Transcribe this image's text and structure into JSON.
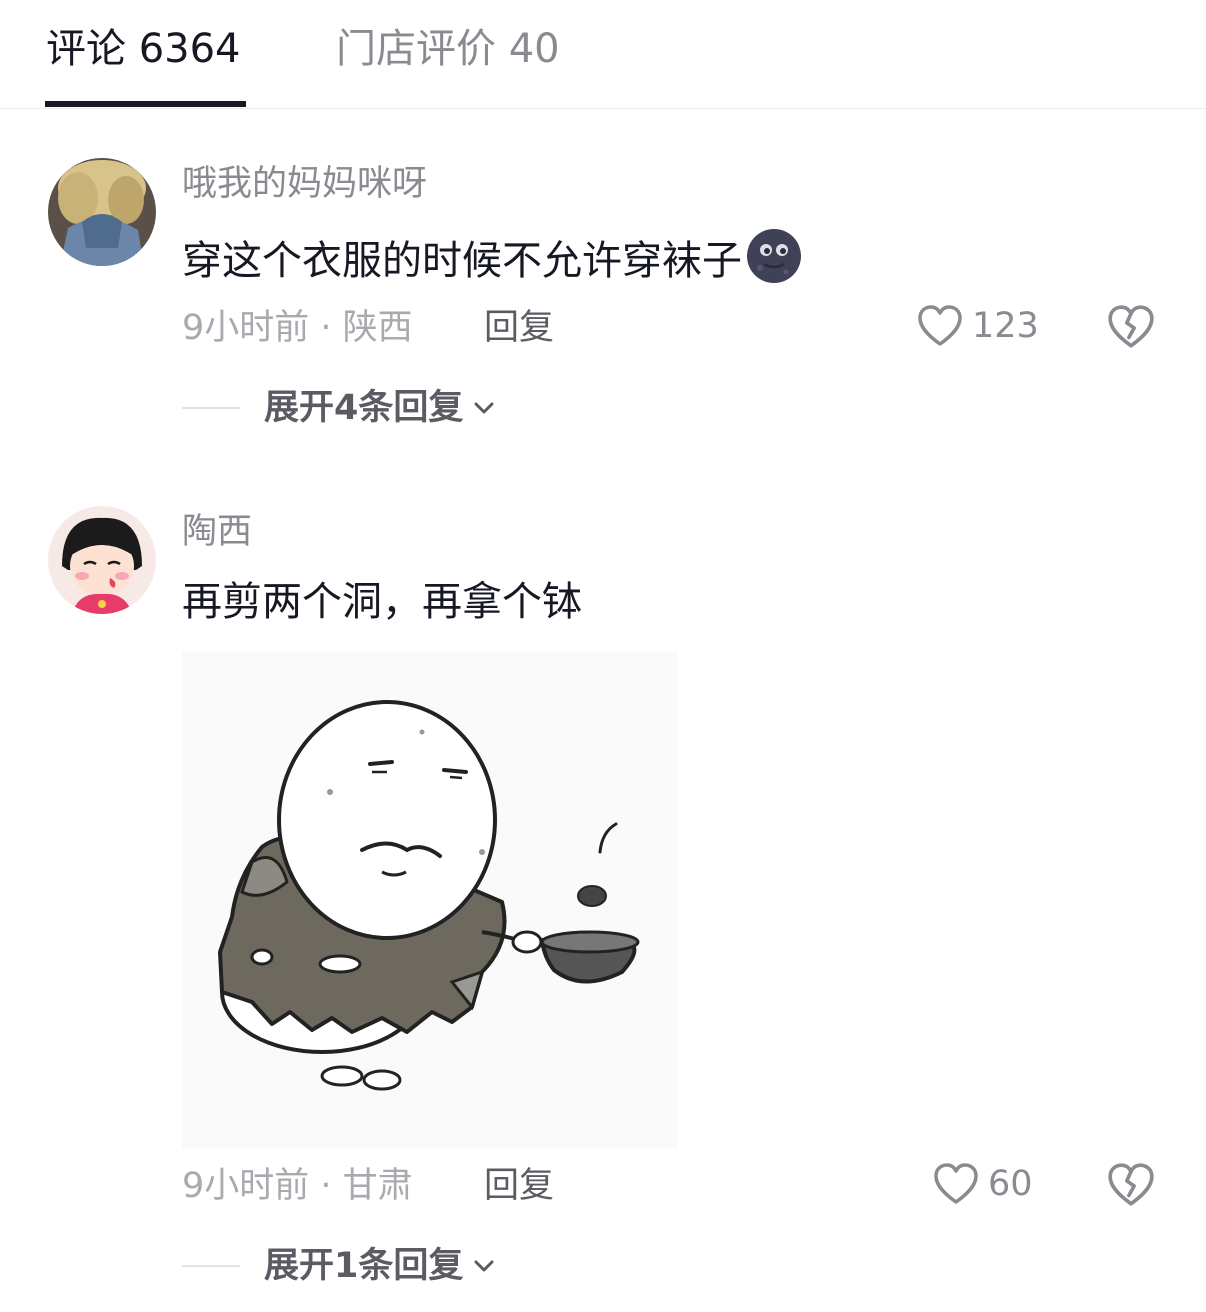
{
  "tabs": {
    "comments": "评论 6364",
    "store_reviews": "门店评价 40"
  },
  "comments": [
    {
      "author": "哦我的妈妈咪呀",
      "text": "穿这个衣服的时候不允许穿袜子",
      "emoji": "new-moon-face-emoji",
      "meta": "9小时前 · 陕西",
      "reply_label": "回复",
      "likes": "123",
      "expand_label": "展开4条回复"
    },
    {
      "author": "陶西",
      "text": "再剪两个洞，再拿个钵",
      "sticker": "beggar-meme-sticker",
      "meta": "9小时前 · 甘肃",
      "reply_label": "回复",
      "likes": "60",
      "expand_label": "展开1条回复"
    }
  ],
  "colors": {
    "primary_text": "#161823",
    "secondary_text": "#8a8b91",
    "meta_text": "#a9aaaf"
  }
}
